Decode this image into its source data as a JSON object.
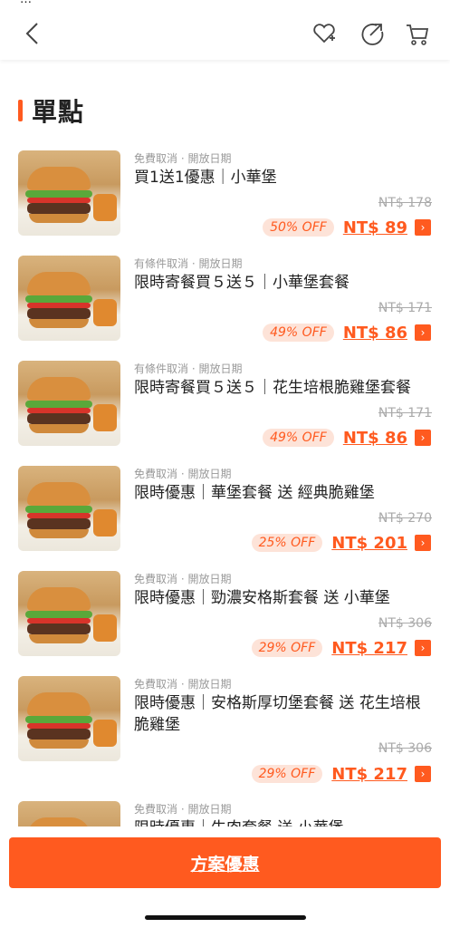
{
  "status_clip": "…",
  "header": {
    "icons": [
      "back-icon",
      "favorite-add-icon",
      "share-icon",
      "cart-icon"
    ]
  },
  "section": {
    "title": "單點"
  },
  "items": [
    {
      "meta": "免費取消 · 開放日期",
      "name": "買1送1優惠｜小華堡",
      "orig": "NT$ 178",
      "off": "50% OFF",
      "now": "NT$ 89"
    },
    {
      "meta": "有條件取消 · 開放日期",
      "name": "限時寄餐買５送５｜小華堡套餐",
      "orig": "NT$ 171",
      "off": "49% OFF",
      "now": "NT$ 86"
    },
    {
      "meta": "有條件取消 · 開放日期",
      "name": "限時寄餐買５送５｜花生培根脆雞堡套餐",
      "orig": "NT$ 171",
      "off": "49% OFF",
      "now": "NT$ 86"
    },
    {
      "meta": "免費取消 · 開放日期",
      "name": "限時優惠｜華堡套餐 送 經典脆雞堡",
      "orig": "NT$ 270",
      "off": "25% OFF",
      "now": "NT$ 201"
    },
    {
      "meta": "免費取消 · 開放日期",
      "name": "限時優惠｜勁濃安格斯套餐 送 小華堡",
      "orig": "NT$ 306",
      "off": "29% OFF",
      "now": "NT$ 217"
    },
    {
      "meta": "免費取消 · 開放日期",
      "name": "限時優惠｜安格斯厚切堡套餐 送 花生培根脆雞堡",
      "orig": "NT$ 306",
      "off": "29% OFF",
      "now": "NT$ 217"
    },
    {
      "meta": "免費取消 · 開放日期",
      "name": "限時優惠｜牛肉套餐 送 小華堡",
      "orig": "",
      "off": "",
      "now": ""
    }
  ],
  "bottom": {
    "cta_label": "方案優惠"
  },
  "colors": {
    "accent": "#ff5a1f",
    "off_bg": "#fde3d8"
  }
}
